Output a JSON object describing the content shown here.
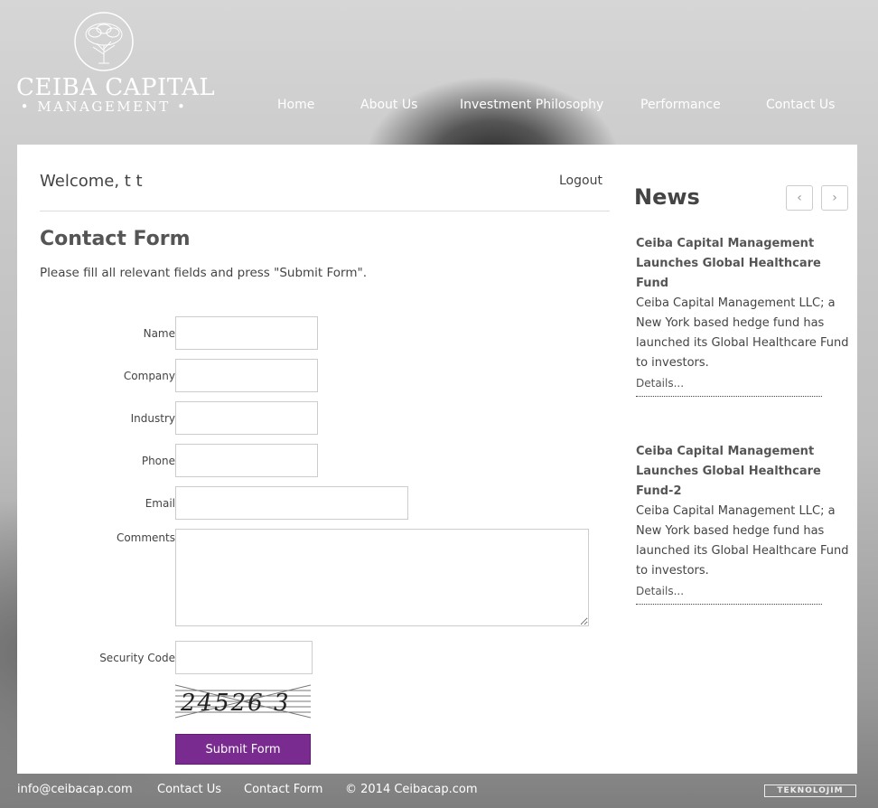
{
  "brand": {
    "name": "CEIBA CAPITAL",
    "sub": "• MANAGEMENT •"
  },
  "nav": [
    {
      "label": "Home"
    },
    {
      "label": "About Us"
    },
    {
      "label": "Investment Philosophy"
    },
    {
      "label": "Performance"
    },
    {
      "label": "Contact Us"
    }
  ],
  "main": {
    "welcome": "Welcome, t t",
    "logout": "Logout",
    "form_title": "Contact Form",
    "form_intro": "Please fill all relevant fields and press \"Submit Form\".",
    "fields": {
      "name": {
        "label": "Name",
        "value": ""
      },
      "company": {
        "label": "Company",
        "value": ""
      },
      "industry": {
        "label": "Industry",
        "value": ""
      },
      "phone": {
        "label": "Phone",
        "value": ""
      },
      "email": {
        "label": "Email",
        "value": ""
      },
      "comments": {
        "label": "Comments",
        "value": ""
      },
      "security": {
        "label": "Security Code",
        "value": ""
      }
    },
    "captcha_text": "24526 3",
    "submit_label": "Submit Form"
  },
  "news": {
    "title": "News",
    "prev_icon": "‹",
    "next_icon": "›",
    "items": [
      {
        "headline": "Ceiba Capital Management Launches Global Healthcare Fund",
        "body": "Ceiba Capital Management LLC; a New York based hedge fund has launched its Global Healthcare Fund to investors.",
        "details": "Details..."
      },
      {
        "headline": "Ceiba Capital Management Launches Global Healthcare Fund-2",
        "body": "Ceiba Capital Management LLC; a New York based hedge fund has launched its Global Healthcare Fund to investors.",
        "details": "Details..."
      }
    ]
  },
  "footer": {
    "email": "info@ceibacap.com",
    "contact": "Contact Us",
    "contact_form": "Contact Form",
    "copyright": "© 2014 Ceibacap.com",
    "badge": "TEKNOLOJIM"
  }
}
